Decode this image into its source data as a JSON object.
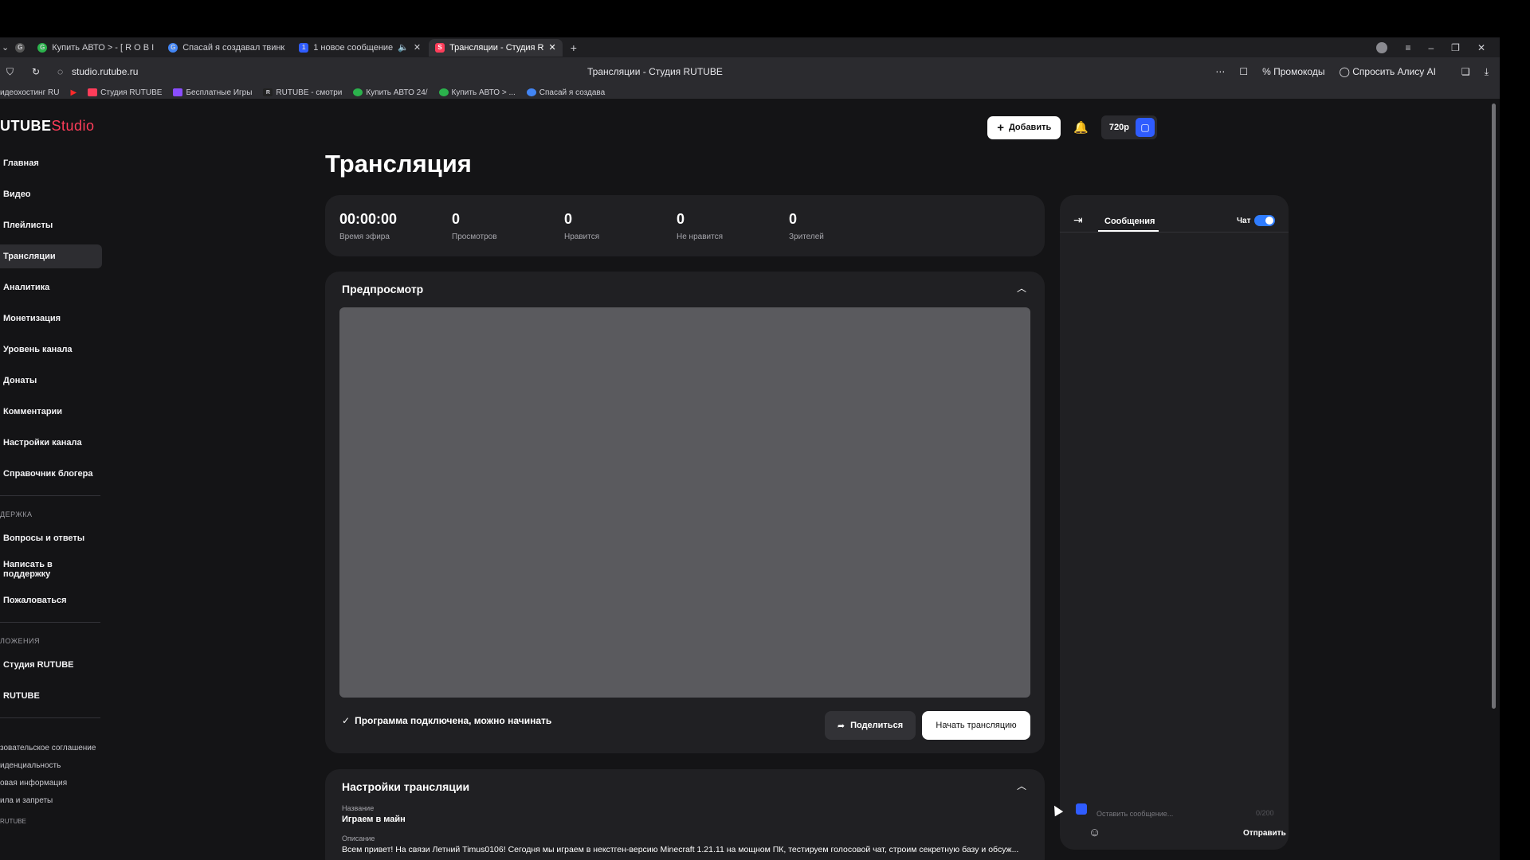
{
  "browser": {
    "tabs": [
      {
        "label": "Купить АВТО > - [ R O B I",
        "fav_color": "#2bb24c"
      },
      {
        "label": "Спасай я создавал твинк",
        "fav_color": "#4285f4"
      },
      {
        "label": "1 новое сообщение",
        "fav_color": "#2f5cff"
      },
      {
        "label": "Трансляции - Студия R",
        "fav_color": "#ff3d5a",
        "active": true
      }
    ],
    "url": "studio.rutube.ru",
    "page_title": "Трансляции - Студия RUTUBE",
    "promo_label": "Промокоды",
    "alice_label": "Спросить Алису AI",
    "bookmarks": [
      "идеохостинг RU",
      "Студия RUTUBE",
      "Бесплатные Игры",
      "RUTUBE - смотри",
      "Купить АВТО 24/",
      "Купить АВТО > ...",
      "Спасай я создава"
    ]
  },
  "header": {
    "logo_main": "UTUBE",
    "logo_studio": "Studio",
    "add_label": "Добавить",
    "quality_label": "720p"
  },
  "sidebar": {
    "items": [
      "Главная",
      "Видео",
      "Плейлисты",
      "Трансляции",
      "Аналитика",
      "Монетизация",
      "Уровень канала",
      "Донаты",
      "Комментарии",
      "Настройки канала",
      "Справочник блогера"
    ],
    "support_label": "ДЕРЖКА",
    "support_items": [
      "Вопросы и ответы",
      "Написать в поддержку",
      "Пожаловаться"
    ],
    "apps_label": "ЛОЖЕНИЯ",
    "apps_items": [
      "Студия RUTUBE",
      "RUTUBE"
    ],
    "footer_links": [
      "зовательское соглашение",
      "иденциальность",
      "овая информация",
      "ила и запреты"
    ],
    "footer_brand": "RUTUBE"
  },
  "main": {
    "title": "Трансляция",
    "stats": [
      {
        "value": "00:00:00",
        "label": "Время эфира"
      },
      {
        "value": "0",
        "label": "Просмотров"
      },
      {
        "value": "0",
        "label": "Нравится"
      },
      {
        "value": "0",
        "label": "Не нравится"
      },
      {
        "value": "0",
        "label": "Зрителей"
      }
    ],
    "preview_title": "Предпросмотр",
    "status_text": "Программа подключена, можно начинать",
    "share_label": "Поделиться",
    "start_label": "Начать трансляцию",
    "settings_title": "Настройки трансляции",
    "name_label": "Название",
    "name_value": "Играем в майн",
    "desc_label": "Описание",
    "desc_value": "Всем привет! На связи Летний Timus0106! Сегодня мы играем в некстген-версию Minecraft 1.21.11 на мощном ПК, тестируем голосовой чат, строим секретную базу и обсуж..."
  },
  "chat": {
    "tab_label": "Сообщения",
    "toggle_label": "Чат",
    "input_placeholder": "Оставить сообщение...",
    "counter": "0/200",
    "send_label": "Отправить"
  }
}
